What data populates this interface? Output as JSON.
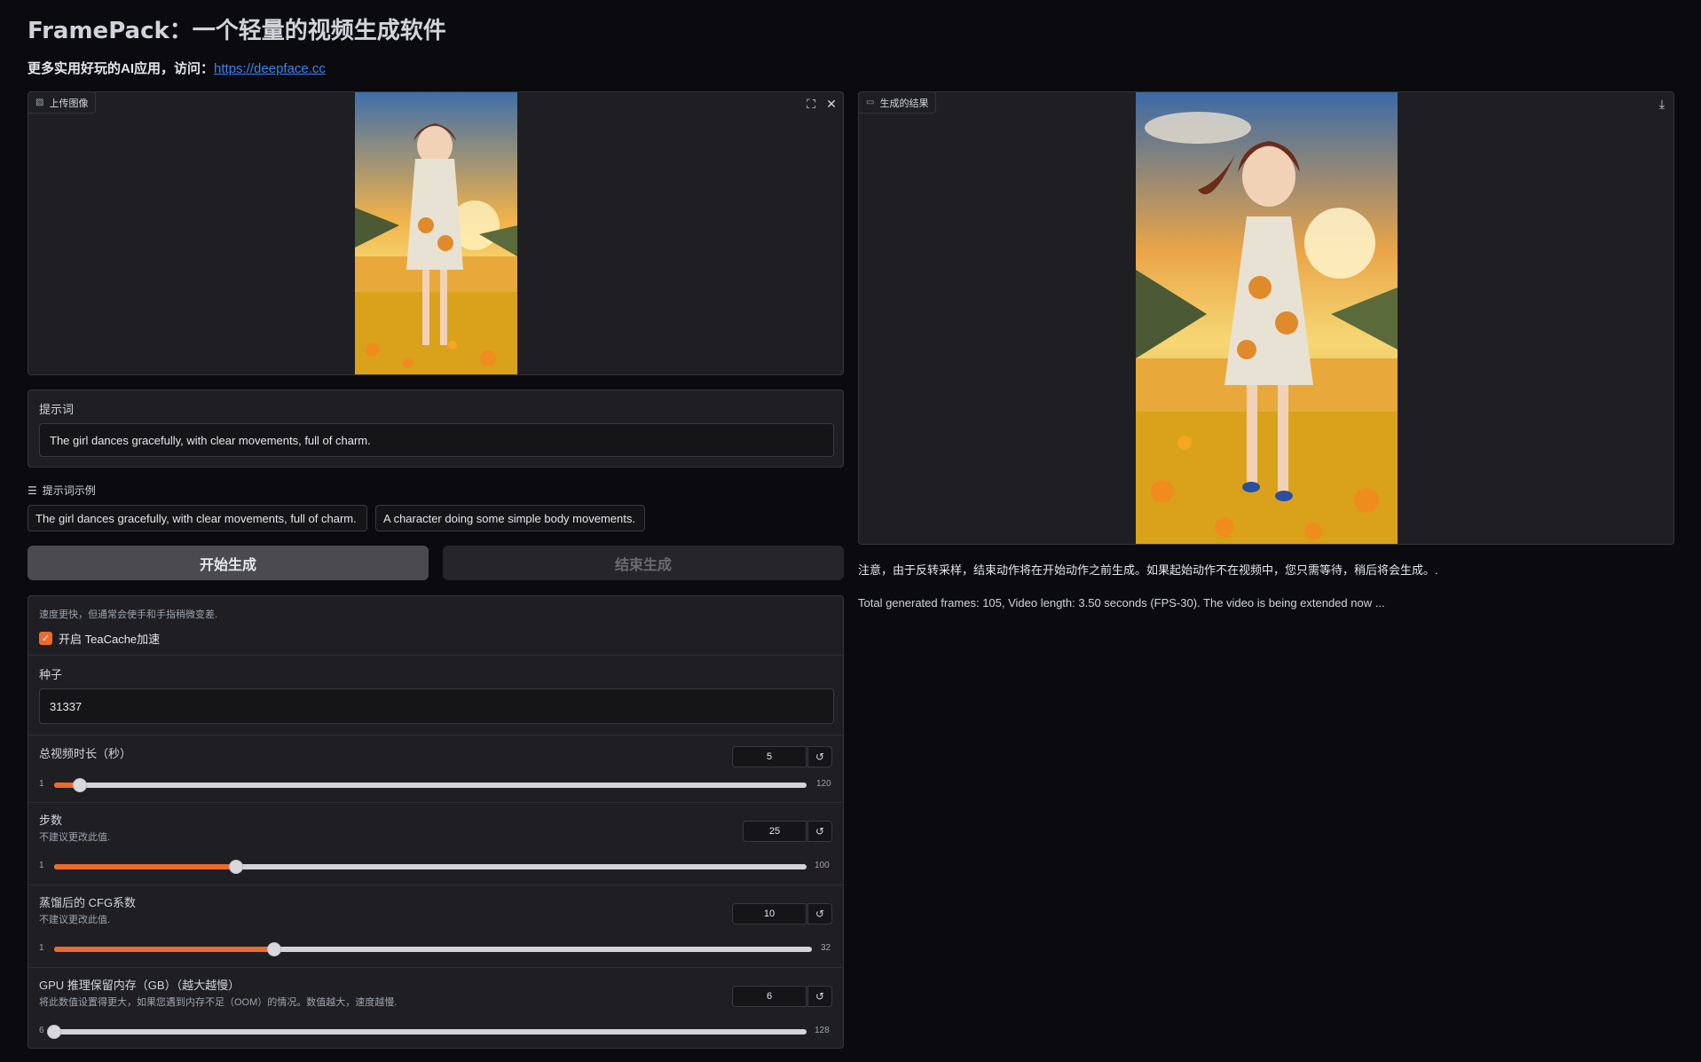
{
  "header": {
    "title": "FramePack：一个轻量的视频生成软件",
    "subtitle_prefix": "更多实用好玩的AI应用，访问：",
    "subtitle_link": "https://deepface.cc"
  },
  "upload_panel": {
    "label": "上传图像",
    "label_icon": "image-icon"
  },
  "result_panel": {
    "label": "生成的结果",
    "label_icon": "video-icon"
  },
  "prompt": {
    "label": "提示词",
    "value": "The girl dances gracefully, with clear movements, full of charm."
  },
  "examples": {
    "label": "提示词示例",
    "items": [
      "The girl dances gracefully, with clear movements, full of charm.",
      "A character doing some simple body movements."
    ]
  },
  "buttons": {
    "start": "开始生成",
    "end": "结束生成"
  },
  "teacache": {
    "hint": "速度更快，但通常会使手和手指稍微变差.",
    "label": "开启 TeaCache加速",
    "checked": true
  },
  "seed": {
    "label": "种子",
    "value": "31337"
  },
  "sliders": {
    "duration": {
      "label": "总视频时长（秒）",
      "value": "5",
      "min": "1",
      "max": "120",
      "fraction": 0.034
    },
    "steps": {
      "label": "步数",
      "hint": "不建议更改此值.",
      "value": "25",
      "min": "1",
      "max": "100",
      "fraction": 0.242
    },
    "cfg": {
      "label": "蒸馏后的 CFG系数",
      "hint": "不建议更改此值.",
      "value": "10",
      "min": "1",
      "max": "32",
      "fraction": 0.29
    },
    "gpu": {
      "label": "GPU 推理保留内存（GB）（越大越慢）",
      "hint": "将此数值设置得更大，如果您遇到内存不足（OOM）的情况。数值越大，速度越慢.",
      "value": "6",
      "min": "6",
      "max": "128",
      "fraction": 0.0
    }
  },
  "notes": {
    "line1": "注意，由于反转采样，结束动作将在开始动作之前生成。如果起始动作不在视频中，您只需等待，稍后将会生成。.",
    "line2": "Total generated frames: 105, Video length: 3.50 seconds (FPS-30). The video is being extended now ..."
  },
  "colors": {
    "accent": "#ea6b2c",
    "link": "#3b82f6",
    "background": "#0b0b0f"
  }
}
